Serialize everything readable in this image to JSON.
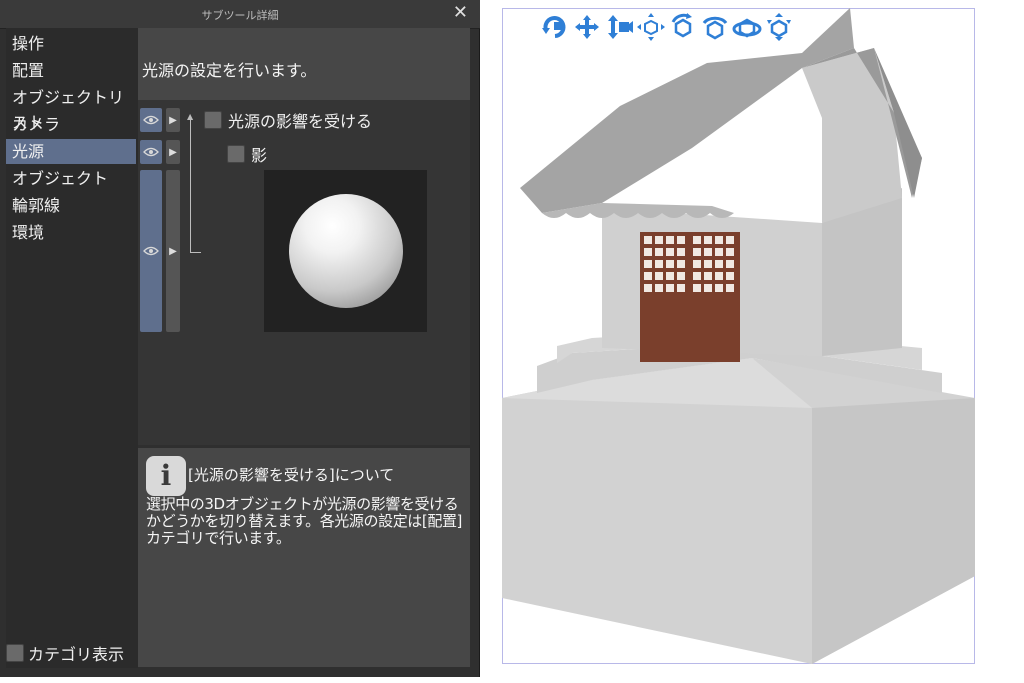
{
  "dialog": {
    "title": "サブツール詳細",
    "close_glyph": "✕",
    "categories": [
      {
        "label": "操作"
      },
      {
        "label": "配置"
      },
      {
        "label": "オブジェクトリスト"
      },
      {
        "label": "カメラ"
      },
      {
        "label": "光源",
        "selected": true
      },
      {
        "label": "オブジェクト"
      },
      {
        "label": "輪郭線"
      },
      {
        "label": "環境"
      }
    ],
    "category_toggle_label": "カテゴリ表示",
    "description": "光源の設定を行います。",
    "options": {
      "affected_by_light": "光源の影響を受ける",
      "shadow": "影"
    },
    "help": {
      "title": "[光源の影響を受ける]について",
      "body": "選択中の3Dオブジェクトが光源の影響を受けるかどうかを切り替えます。各光源の設定は[配置]カテゴリで行います。"
    }
  },
  "viewport": {
    "toolbar_icons": [
      "rotate-camera-icon",
      "pan-camera-icon",
      "dolly-camera-icon",
      "move-object-icon",
      "rotate-object-icon",
      "rotate-object-vertical-icon",
      "rotate-object-horizontal-icon",
      "scale-object-icon"
    ],
    "icon_color": "#2f7fd6"
  },
  "colors": {
    "panel_bg": "#2f2f2f",
    "selected_bg": "#5f6f8d",
    "door": "#7a3f2c"
  }
}
